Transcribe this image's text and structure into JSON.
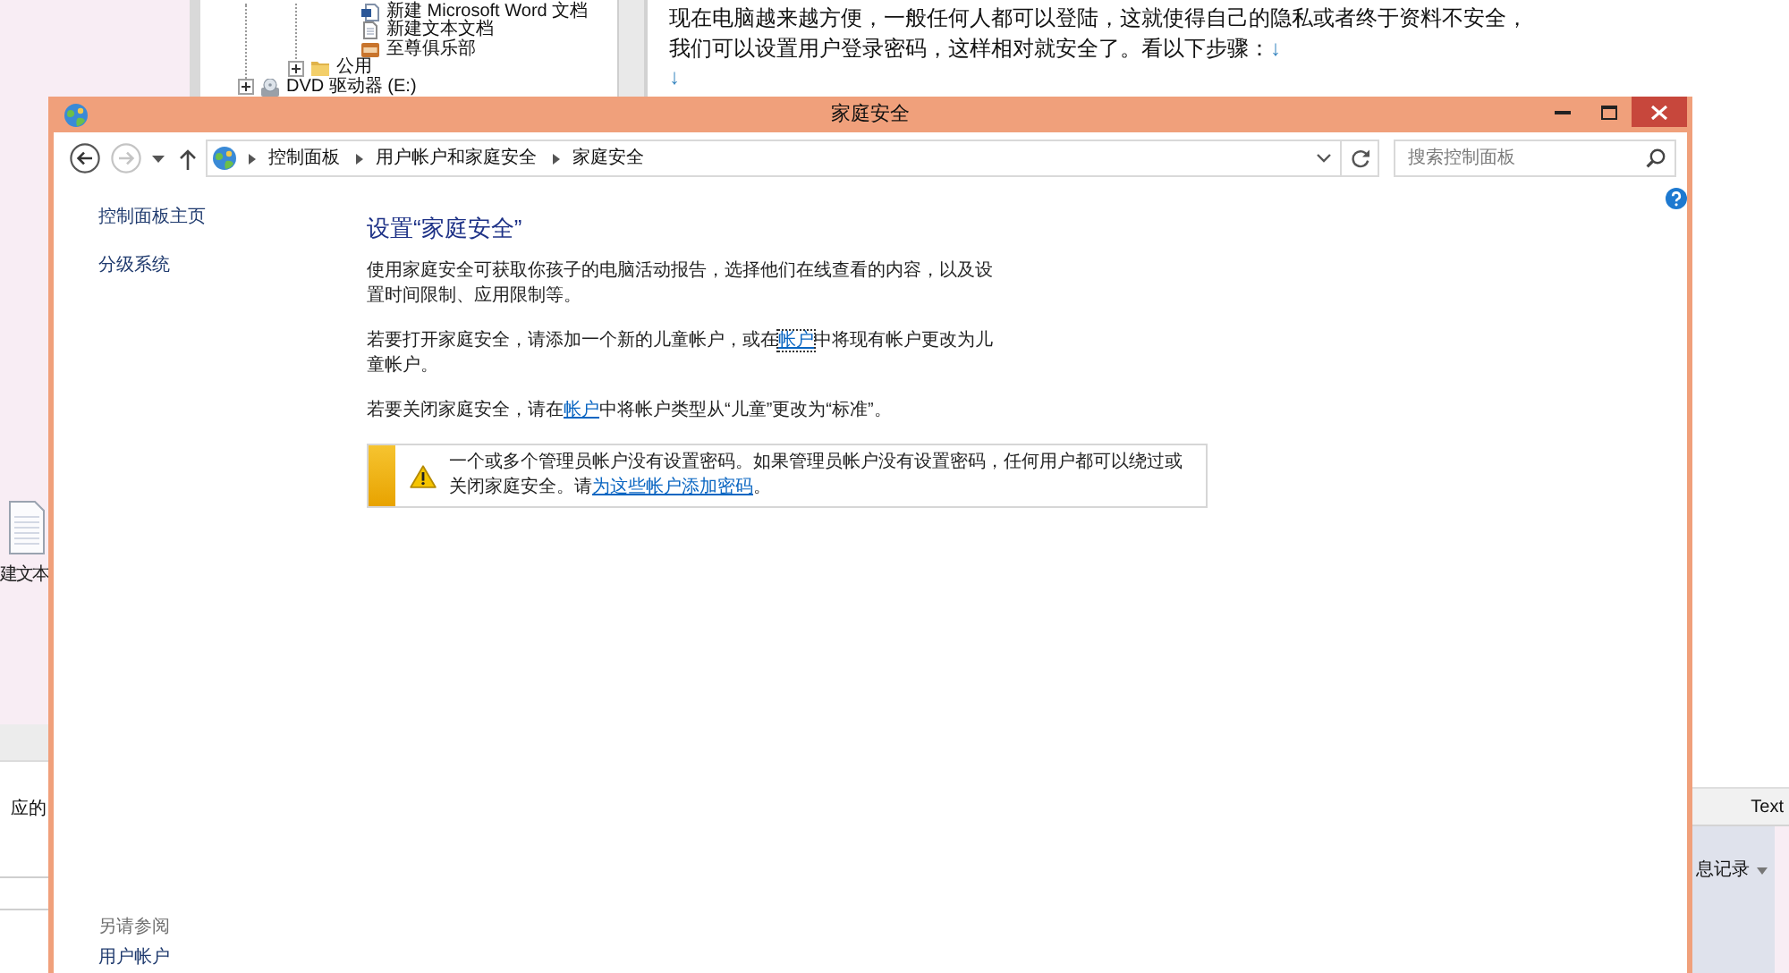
{
  "background": {
    "explorer_tree": {
      "items": [
        {
          "children": [
            {
              "children": [
                {
                  "label": "新建 Microsoft Word 文档",
                  "kind": "word"
                },
                {
                  "label": "新建文本文档",
                  "kind": "text"
                },
                {
                  "label": "至尊俱乐部",
                  "kind": "image"
                }
              ]
            },
            {
              "label": "公用",
              "kind": "folder",
              "expanded": false
            }
          ]
        },
        {
          "label": "DVD 驱动器 (E:)",
          "kind": "drive",
          "expanded": false
        }
      ]
    },
    "document": {
      "lines": [
        {
          "text": "现在电脑越来越方便，一般任何人都可以登陆，这就使得自己的隐私或者终于资料不安全，"
        },
        {
          "text": "我们可以设置用户登录密码，这样相对就安全了。看以下步骤：",
          "end_mark": "↓"
        },
        {
          "end_mark": "↓"
        }
      ]
    },
    "desktop_icon": {
      "label": "建文本"
    },
    "lower_left_panel": {
      "text": "应的"
    },
    "lower_right_panel": {
      "header": "Text",
      "dropdown": "息记录"
    }
  },
  "window": {
    "title": "家庭安全",
    "navigation": {
      "back": {
        "disabled": false
      },
      "forward": {
        "disabled": true
      }
    },
    "address_bar": {
      "breadcrumbs": [
        "控制面板",
        "用户帐户和家庭安全",
        "家庭安全"
      ]
    },
    "search": {
      "placeholder": "搜索控制面板"
    },
    "sidebar": {
      "links": [
        "控制面板主页",
        "分级系统"
      ],
      "see_also": {
        "heading": "另请参阅",
        "links": [
          "用户帐户"
        ]
      }
    },
    "main": {
      "heading": "设置“家庭安全”",
      "paragraphs": [
        {
          "segments": [
            {
              "kind": "text",
              "text": "使用家庭安全可获取你孩子的电脑活动报告，选择他们在线查看的内容，以及设置时间限制、应用限制等。"
            }
          ]
        },
        {
          "segments": [
            {
              "kind": "text",
              "text": "若要打开家庭安全，请添加一个新的儿童帐户，或在"
            },
            {
              "kind": "link",
              "text": "帐户",
              "focused": true
            },
            {
              "kind": "text",
              "text": "中将现有帐户更改为儿童帐户。"
            }
          ]
        },
        {
          "segments": [
            {
              "kind": "text",
              "text": "若要关闭家庭安全，请在"
            },
            {
              "kind": "link",
              "text": "帐户",
              "focused": false
            },
            {
              "kind": "text",
              "text": "中将帐户类型从“儿童”更改为“标准”。"
            }
          ]
        }
      ],
      "warning": {
        "segments": [
          {
            "kind": "text",
            "text": "一个或多个管理员帐户没有设置密码。如果管理员帐户没有设置密码，任何用户都可以绕过或关闭家庭安全。请"
          },
          {
            "kind": "link",
            "text": "为这些帐户添加密码",
            "focused": false
          },
          {
            "kind": "text",
            "text": "。"
          }
        ]
      }
    }
  }
}
